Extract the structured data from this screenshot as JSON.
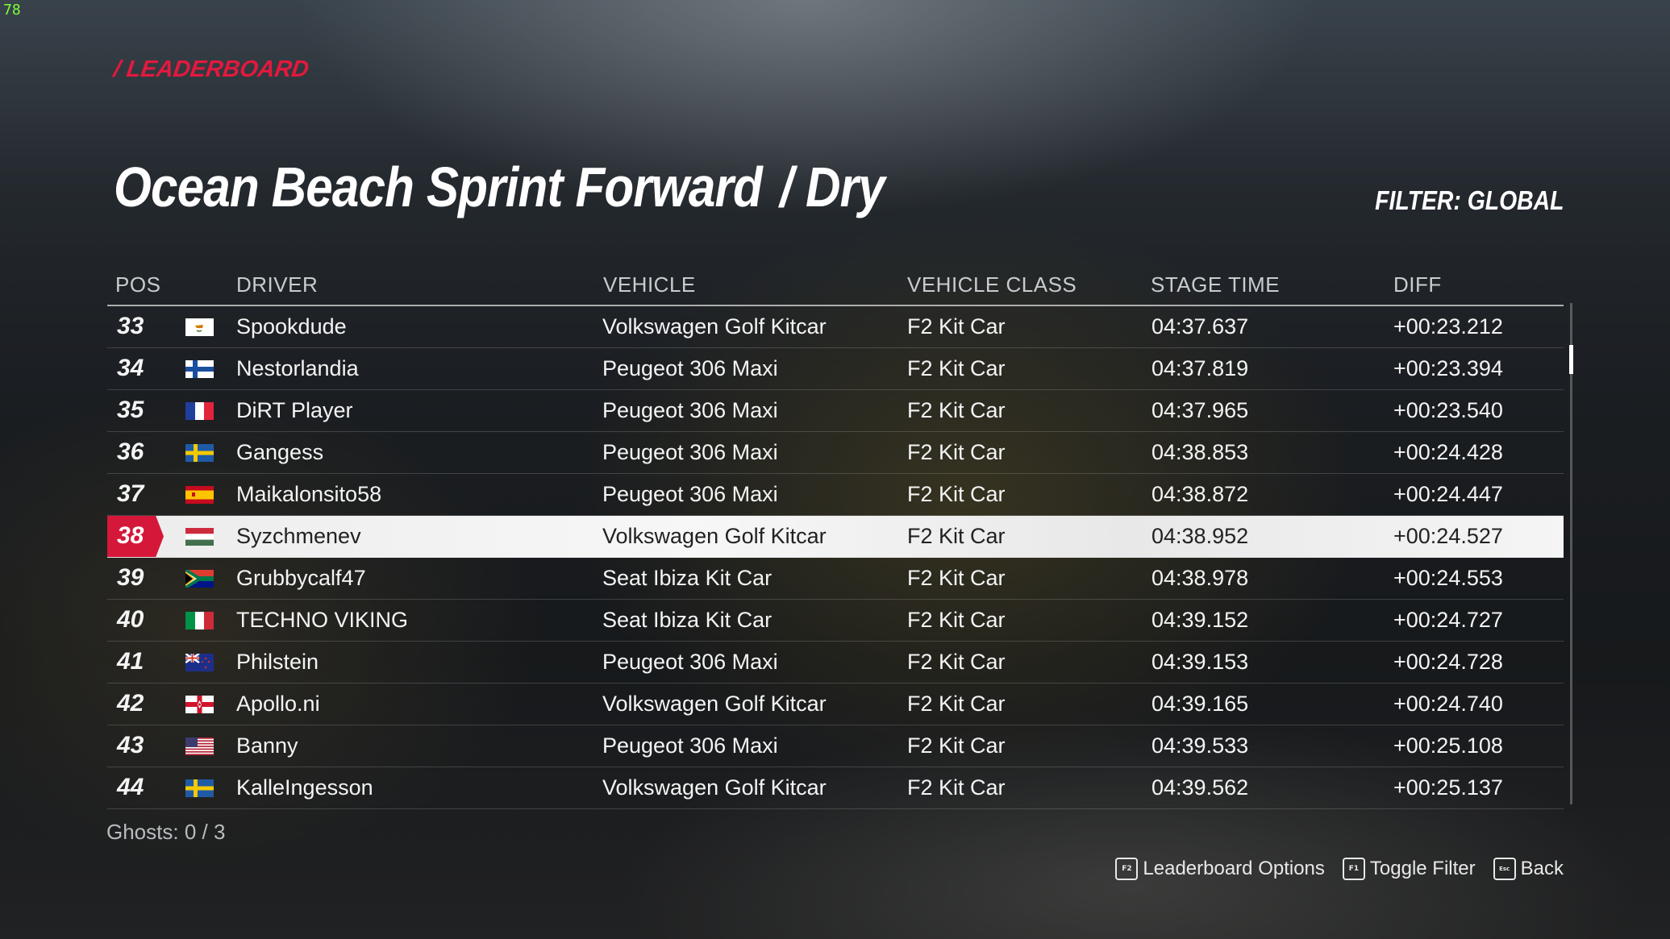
{
  "fps": "78",
  "breadcrumb": "/ LEADERBOARD",
  "title": {
    "stage": "Ocean Beach Sprint Forward",
    "condition": "/ Dry"
  },
  "filter": "FILTER: GLOBAL",
  "columns": {
    "pos": "POS",
    "driver": "DRIVER",
    "vehicle": "VEHICLE",
    "vehicle_class": "VEHICLE CLASS",
    "stage_time": "STAGE TIME",
    "diff": "DIFF"
  },
  "rows": [
    {
      "pos": "33",
      "flag": "cyprus-flag",
      "driver": "Spookdude",
      "vehicle": "Volkswagen Golf Kitcar",
      "vehicle_class": "F2 Kit Car",
      "stage_time": "04:37.637",
      "diff": "+00:23.212"
    },
    {
      "pos": "34",
      "flag": "finland-flag",
      "driver": "Nestorlandia",
      "vehicle": "Peugeot 306 Maxi",
      "vehicle_class": "F2 Kit Car",
      "stage_time": "04:37.819",
      "diff": "+00:23.394"
    },
    {
      "pos": "35",
      "flag": "france-flag",
      "driver": "DiRT Player",
      "vehicle": "Peugeot 306 Maxi",
      "vehicle_class": "F2 Kit Car",
      "stage_time": "04:37.965",
      "diff": "+00:23.540"
    },
    {
      "pos": "36",
      "flag": "sweden-flag",
      "driver": "Gangess",
      "vehicle": "Peugeot 306 Maxi",
      "vehicle_class": "F2 Kit Car",
      "stage_time": "04:38.853",
      "diff": "+00:24.428"
    },
    {
      "pos": "37",
      "flag": "spain-flag",
      "driver": "Maikalonsito58",
      "vehicle": "Peugeot 306 Maxi",
      "vehicle_class": "F2 Kit Car",
      "stage_time": "04:38.872",
      "diff": "+00:24.447"
    },
    {
      "pos": "38",
      "flag": "hungary-flag",
      "driver": "Syzchmenev",
      "vehicle": "Volkswagen Golf Kitcar",
      "vehicle_class": "F2 Kit Car",
      "stage_time": "04:38.952",
      "diff": "+00:24.527",
      "selected": true
    },
    {
      "pos": "39",
      "flag": "south-africa-flag",
      "driver": "Grubbycalf47",
      "vehicle": "Seat Ibiza Kit Car",
      "vehicle_class": "F2 Kit Car",
      "stage_time": "04:38.978",
      "diff": "+00:24.553"
    },
    {
      "pos": "40",
      "flag": "italy-flag",
      "driver": "TECHNO VIKING",
      "vehicle": "Seat Ibiza Kit Car",
      "vehicle_class": "F2 Kit Car",
      "stage_time": "04:39.152",
      "diff": "+00:24.727"
    },
    {
      "pos": "41",
      "flag": "new-zealand-flag",
      "driver": "Philstein",
      "vehicle": "Peugeot 306 Maxi",
      "vehicle_class": "F2 Kit Car",
      "stage_time": "04:39.153",
      "diff": "+00:24.728"
    },
    {
      "pos": "42",
      "flag": "northern-ireland-flag",
      "driver": "Apollo.ni",
      "vehicle": "Volkswagen Golf Kitcar",
      "vehicle_class": "F2 Kit Car",
      "stage_time": "04:39.165",
      "diff": "+00:24.740"
    },
    {
      "pos": "43",
      "flag": "usa-flag",
      "driver": "Banny",
      "vehicle": "Peugeot 306 Maxi",
      "vehicle_class": "F2 Kit Car",
      "stage_time": "04:39.533",
      "diff": "+00:25.108"
    },
    {
      "pos": "44",
      "flag": "sweden-flag",
      "driver": "KalleIngesson",
      "vehicle": "Volkswagen Golf Kitcar",
      "vehicle_class": "F2 Kit Car",
      "stage_time": "04:39.562",
      "diff": "+00:25.137"
    }
  ],
  "ghosts": "Ghosts: 0 / 3",
  "footer": {
    "options": {
      "key": "F2",
      "label": "Leaderboard Options"
    },
    "filter": {
      "key": "F1",
      "label": "Toggle Filter"
    },
    "back": {
      "key": "Esc",
      "label": "Back"
    }
  },
  "colors": {
    "accent": "#d5173a",
    "crumb": "#e2193e"
  }
}
